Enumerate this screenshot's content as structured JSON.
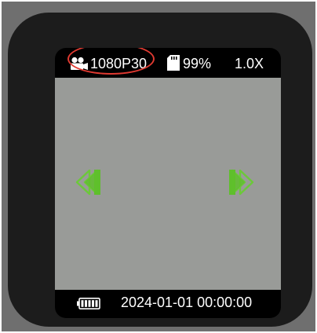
{
  "status_bar": {
    "resolution": "1080P30",
    "storage": "99%",
    "zoom": "1.0X",
    "icons": {
      "mode": "video-camera-icon",
      "storage": "sd-card-icon"
    }
  },
  "viewfinder": {
    "icons": {
      "left": "arrow-left-icon",
      "right": "arrow-right-icon"
    },
    "arrow_color": "#6cc83a",
    "background_color": "#999b98"
  },
  "bottom_bar": {
    "datetime": "2024-01-01  00:00:00",
    "icons": {
      "battery": "battery-icon"
    }
  },
  "colors": {
    "highlight": "#e03a31",
    "screen": "#000000",
    "bezel": "#1c1c1c"
  }
}
